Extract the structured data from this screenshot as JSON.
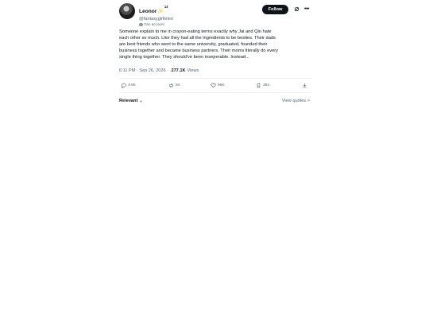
{
  "author": {
    "display_name": "Leonor",
    "name_emoji": "✨",
    "name_sup": "13",
    "handle": "@fantasygirlleleo",
    "badge_label": "Fan account"
  },
  "header": {
    "follow_label": "Follow",
    "more_label": "•••"
  },
  "post": {
    "lines": [
      "Someone explain to me in crayon-eating terms exactly why Jai and Qin hate",
      "each other so much. Like they had all the ingredients to be besties. Their dads",
      "are best friends who went to the same university, graduated, founded their",
      "business together and became business partners. Their moms literally do every",
      "single thing together. They should've been inseperable. Instead..."
    ],
    "time": "6:11 PM",
    "date": "Sep 26, 2026",
    "separator": "·",
    "views_count": "277.1K",
    "views_label": "Views"
  },
  "actions": {
    "replies": "3.9K",
    "reposts": "94",
    "likes": "95K",
    "bookmarks": "384"
  },
  "replies_bar": {
    "sort_label": "Relevant",
    "view_quotes_label": "View quotes >"
  },
  "icons": [
    "reply-icon",
    "repost-icon",
    "like-icon",
    "bookmark-icon",
    "share-icon",
    "grok-icon",
    "more-icon",
    "chevron-down-icon"
  ],
  "colors": {
    "text": "#0f1419",
    "secondary": "#536471",
    "follow_bg": "#0f1419",
    "divider": "#eff3f4"
  }
}
